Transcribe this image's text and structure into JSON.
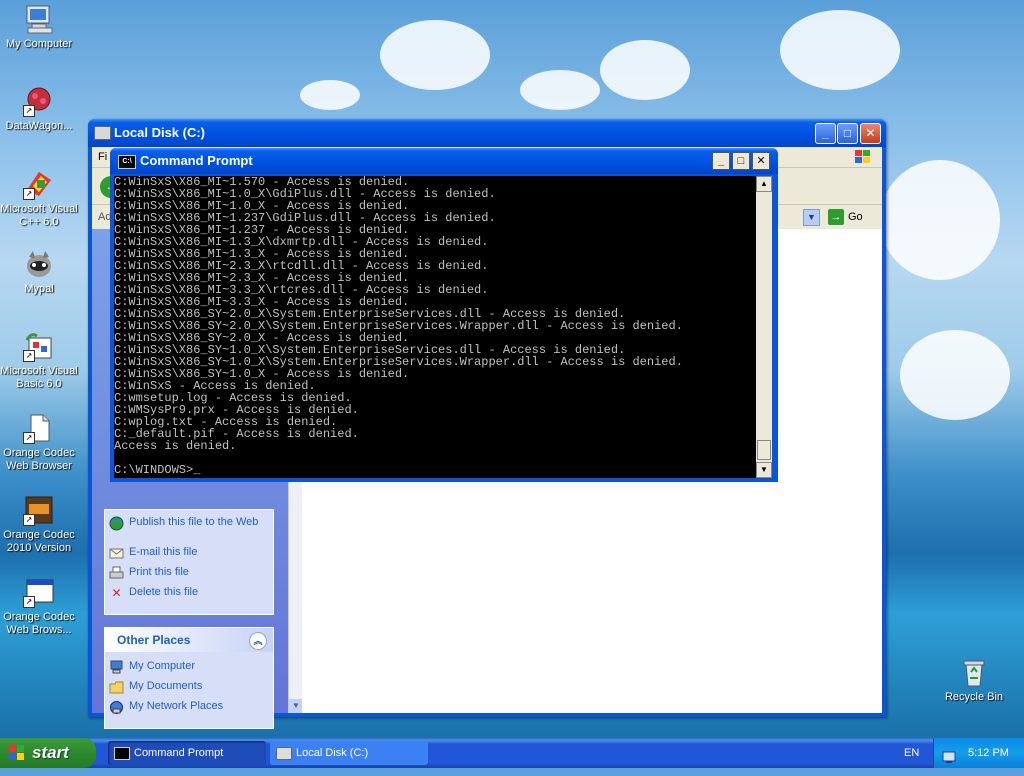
{
  "desktop": {
    "icons": [
      {
        "label": "My Computer"
      },
      {
        "label": "DataWagon..."
      },
      {
        "label": "Microsoft Visual C++ 6.0"
      },
      {
        "label": "Mypal"
      },
      {
        "label": "Microsoft Visual Basic 6.0"
      },
      {
        "label": "Orange Codec Web Browser"
      },
      {
        "label": "Orange Codec 2010 Version"
      },
      {
        "label": "Orange Codec Web Brows..."
      },
      {
        "label": "Recycle Bin"
      }
    ]
  },
  "explorer": {
    "title": "Local Disk (C:)",
    "menu_partial": "Fi",
    "address_label_partial": "Ad",
    "go_label": "Go",
    "file_tasks": [
      {
        "label": "Publish this file to the Web",
        "icon": "globe-icon"
      },
      {
        "label": "E-mail this file",
        "icon": "email-icon"
      },
      {
        "label": "Print this file",
        "icon": "printer-icon"
      },
      {
        "label": "Delete this file",
        "icon": "delete-icon"
      }
    ],
    "other_places": {
      "title": "Other Places",
      "items": [
        {
          "label": "My Computer",
          "icon": "computer-icon"
        },
        {
          "label": "My Documents",
          "icon": "folder-icon"
        },
        {
          "label": "My Network Places",
          "icon": "network-icon"
        }
      ]
    }
  },
  "cmd": {
    "title": "Command Prompt",
    "lines": [
      "C:WinSxS\\X86_MI~1.570 - Access is denied.",
      "C:WinSxS\\X86_MI~1.0_X\\GdiPlus.dll - Access is denied.",
      "C:WinSxS\\X86_MI~1.0_X - Access is denied.",
      "C:WinSxS\\X86_MI~1.237\\GdiPlus.dll - Access is denied.",
      "C:WinSxS\\X86_MI~1.237 - Access is denied.",
      "C:WinSxS\\X86_MI~1.3_X\\dxmrtp.dll - Access is denied.",
      "C:WinSxS\\X86_MI~1.3_X - Access is denied.",
      "C:WinSxS\\X86_MI~2.3_X\\rtcdll.dll - Access is denied.",
      "C:WinSxS\\X86_MI~2.3_X - Access is denied.",
      "C:WinSxS\\X86_MI~3.3_X\\rtcres.dll - Access is denied.",
      "C:WinSxS\\X86_MI~3.3_X - Access is denied.",
      "C:WinSxS\\X86_SY~2.0_X\\System.EnterpriseServices.dll - Access is denied.",
      "C:WinSxS\\X86_SY~2.0_X\\System.EnterpriseServices.Wrapper.dll - Access is denied.",
      "C:WinSxS\\X86_SY~2.0_X - Access is denied.",
      "C:WinSxS\\X86_SY~1.0_X\\System.EnterpriseServices.dll - Access is denied.",
      "C:WinSxS\\X86_SY~1.0_X\\System.EnterpriseServices.Wrapper.dll - Access is denied.",
      "C:WinSxS\\X86_SY~1.0_X - Access is denied.",
      "C:WinSxS - Access is denied.",
      "C:wmsetup.log - Access is denied.",
      "C:WMSysPr9.prx - Access is denied.",
      "C:wplog.txt - Access is denied.",
      "C:_default.pif - Access is denied.",
      "Access is denied.",
      "",
      "C:\\WINDOWS>_"
    ]
  },
  "taskbar": {
    "start_label": "start",
    "items": [
      {
        "label": "Command Prompt"
      },
      {
        "label": "Local Disk (C:)"
      }
    ],
    "language": "EN",
    "clock": "5:12 PM"
  },
  "colors": {
    "title_blue": "#0054e3",
    "start_green": "#2e8a2e",
    "link_blue": "#215dc6"
  }
}
